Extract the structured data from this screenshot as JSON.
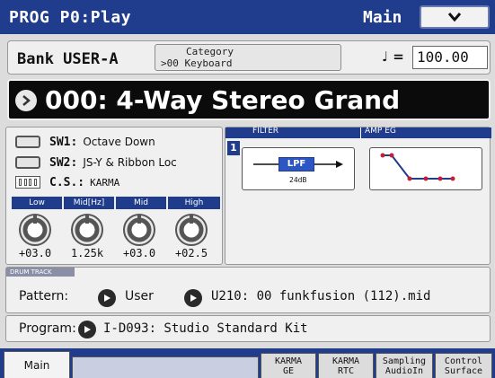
{
  "header": {
    "mode": "PROG P0:Play",
    "page": "Main"
  },
  "bank_row": {
    "bank": "Bank USER-A",
    "category_label": "Category",
    "category_value": ">00 Keyboard",
    "tempo_symbol": "♩ =",
    "tempo_value": "100.00"
  },
  "program": {
    "name": "000: 4-Way Stereo Grand"
  },
  "switches": [
    {
      "name": "SW1:",
      "function": "Octave Down"
    },
    {
      "name": "SW2:",
      "function": "JS-Y & Ribbon Loc"
    },
    {
      "name": "C.S.:",
      "function": "KARMA"
    }
  ],
  "eq": {
    "headers": [
      "Low",
      "Mid[Hz]",
      "Mid",
      "High"
    ],
    "values": [
      "+03.0",
      "1.25k",
      "+03.0",
      "+02.5"
    ]
  },
  "filter": {
    "header": "FILTER",
    "badge": "1",
    "type": "LPF",
    "slope": "24dB"
  },
  "amp_eg": {
    "header": "AMP EG"
  },
  "drum_track": {
    "header": "DRUM TRACK",
    "pattern_label": "Pattern:",
    "pattern_bank": "User",
    "pattern_value": "U210: 00 funkfusion (112).mid",
    "program_label": "Program:",
    "program_value": "I-D093: Studio Standard Kit"
  },
  "tabs": {
    "main": "Main",
    "karma_ge_1": "KARMA",
    "karma_ge_2": "GE",
    "karma_rtc_1": "KARMA",
    "karma_rtc_2": "RTC",
    "sampling_1": "Sampling",
    "sampling_2": "AudioIn",
    "control_1": "Control",
    "control_2": "Surface"
  },
  "colors": {
    "title_bar": "#1f3d8c",
    "panel": "#f0f0f0",
    "lpf_block": "#2c56c4",
    "amp_eg_curve": "#1f3d8c",
    "amp_eg_points": "#c0203a"
  }
}
